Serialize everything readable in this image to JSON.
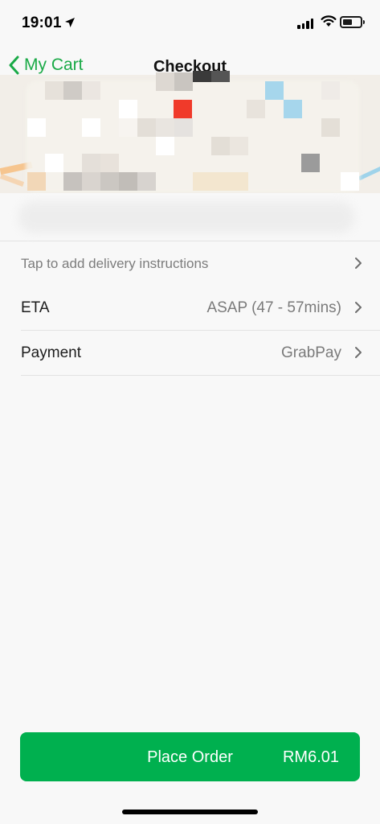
{
  "status_bar": {
    "time": "19:01",
    "icons": [
      "location-arrow-icon",
      "signal-icon",
      "wifi-icon",
      "battery-icon"
    ]
  },
  "nav": {
    "back_label": "My Cart",
    "title": "Checkout"
  },
  "rows": {
    "instructions": {
      "label": "Tap to add delivery instructions"
    },
    "eta": {
      "label": "ETA",
      "value": "ASAP (47 - 57mins)"
    },
    "payment": {
      "label": "Payment",
      "value": "GrabPay"
    }
  },
  "place_order": {
    "label": "Place Order",
    "price": "RM6.01"
  },
  "colors": {
    "accent": "#1aaa47",
    "button": "#00b04f",
    "map_marker": "#f03a2a"
  }
}
